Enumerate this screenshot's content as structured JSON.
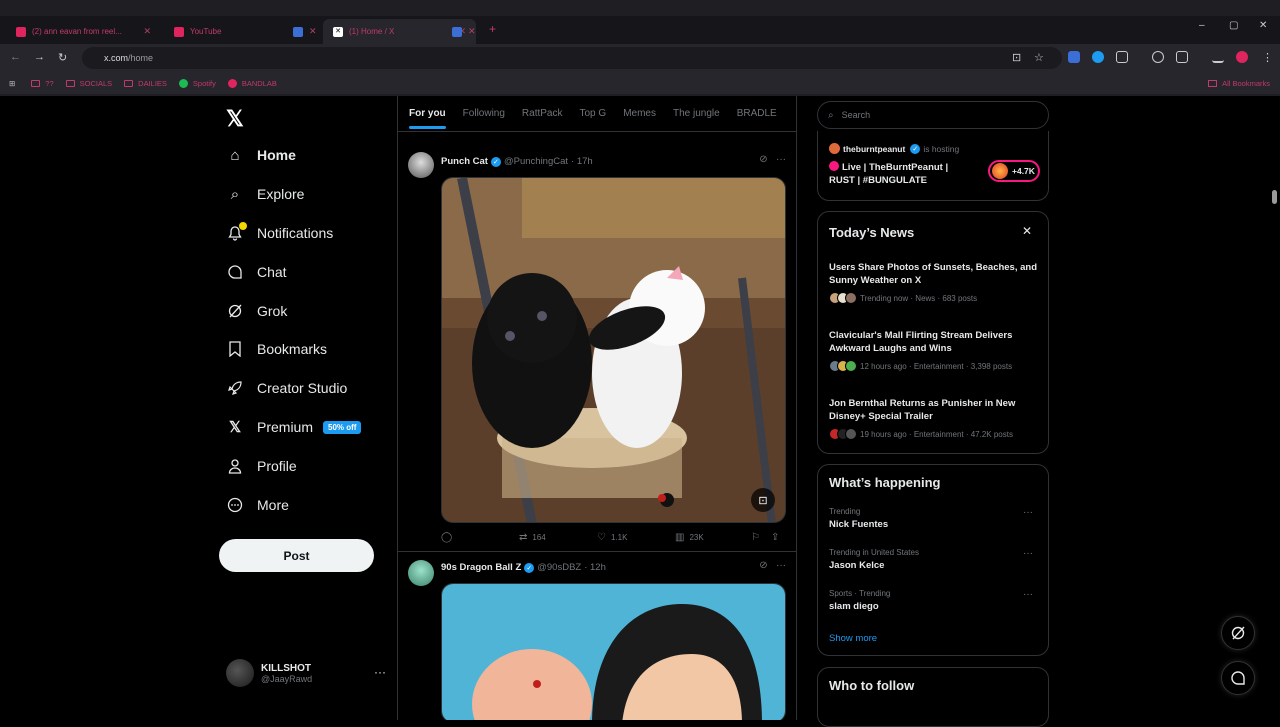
{
  "browser": {
    "tabs": [
      {
        "title": "(2) ann eavan from reel...",
        "color": "#e0245e",
        "close": "✕"
      },
      {
        "title": "YouTube",
        "color": "#e0245e",
        "close": ""
      },
      {
        "title": "",
        "color": "#3b6fd6",
        "close": "✕"
      },
      {
        "title": "(1) Home / X",
        "color": "#ffffff",
        "close": "✕"
      },
      {
        "title": "",
        "color": "#3b6fd6",
        "close": "✕"
      }
    ],
    "new_tab": "+",
    "url_host": "x.com",
    "url_path": "/home",
    "bookmarks": [
      {
        "label": "??"
      },
      {
        "label": "SOCIALS"
      },
      {
        "label": "DAILIES"
      },
      {
        "label": "Spotify"
      },
      {
        "label": "BANDLAB"
      }
    ],
    "all_bookmarks": "All Bookmarks",
    "win": {
      "min": "–",
      "max": "▢",
      "close": "✕"
    }
  },
  "nav": {
    "logo": "𝕏",
    "items": [
      {
        "label": "Home",
        "icon": "home-icon",
        "glyph": "⌂"
      },
      {
        "label": "Explore",
        "icon": "search-icon",
        "glyph": "⌕"
      },
      {
        "label": "Notifications",
        "icon": "bell-icon",
        "glyph": "🔔"
      },
      {
        "label": "Chat",
        "icon": "chat-icon",
        "glyph": "◯"
      },
      {
        "label": "Grok",
        "icon": "grok-icon",
        "glyph": "⊘"
      },
      {
        "label": "Bookmarks",
        "icon": "bookmark-icon",
        "glyph": "⚐"
      },
      {
        "label": "Creator Studio",
        "icon": "rocket-icon",
        "glyph": "➶"
      },
      {
        "label": "Premium",
        "icon": "x-icon",
        "glyph": "✕"
      },
      {
        "label": "Profile",
        "icon": "person-icon",
        "glyph": "⚇"
      },
      {
        "label": "More",
        "icon": "more-circle-icon",
        "glyph": "⋯"
      }
    ],
    "premium_badge": "50% off",
    "post_button": "Post",
    "account": {
      "name": "KILLSHOT",
      "handle": "@JaayRawd",
      "more": "···"
    }
  },
  "feed": {
    "tabs": [
      "For you",
      "Following",
      "RattPack",
      "Top G",
      "Memes",
      "The jungle",
      "BRADLE"
    ],
    "tweets": [
      {
        "name": "Punch Cat",
        "handle": "@PunchingCat",
        "time": "· 17h",
        "replies": "",
        "reposts": "164",
        "likes": "1.1K",
        "views": "23K"
      },
      {
        "name": "90s Dragon Ball Z",
        "handle": "@90sDBZ",
        "time": "· 12h"
      }
    ]
  },
  "sidebar": {
    "search_placeholder": "Search",
    "live": {
      "host": "theburntpeanut",
      "hosting": "is hosting",
      "title": "Live | TheBurntPeanut | RUST | #BUNGULATE",
      "count": "+4.7K"
    },
    "news": {
      "title": "Today’s News",
      "close": "✕",
      "items": [
        {
          "headline": "Users Share Photos of Sunsets, Beaches, and Sunny Weather on X",
          "meta": "Trending now · News · 683 posts"
        },
        {
          "headline": "Clavicular's Mall Flirting Stream Delivers Awkward Laughs and Wins",
          "meta": "12 hours ago · Entertainment · 3,398 posts"
        },
        {
          "headline": "Jon Bernthal Returns as Punisher in New Disney+ Special Trailer",
          "meta": "19 hours ago · Entertainment · 47.2K posts"
        }
      ]
    },
    "happening": {
      "title": "What’s happening",
      "trends": [
        {
          "meta": "Trending",
          "name": "Nick Fuentes"
        },
        {
          "meta": "Trending in United States",
          "name": "Jason Kelce"
        },
        {
          "meta": "Sports · Trending",
          "name": "slam diego"
        }
      ],
      "show_more": "Show more"
    },
    "who_to_follow": "Who to follow"
  }
}
